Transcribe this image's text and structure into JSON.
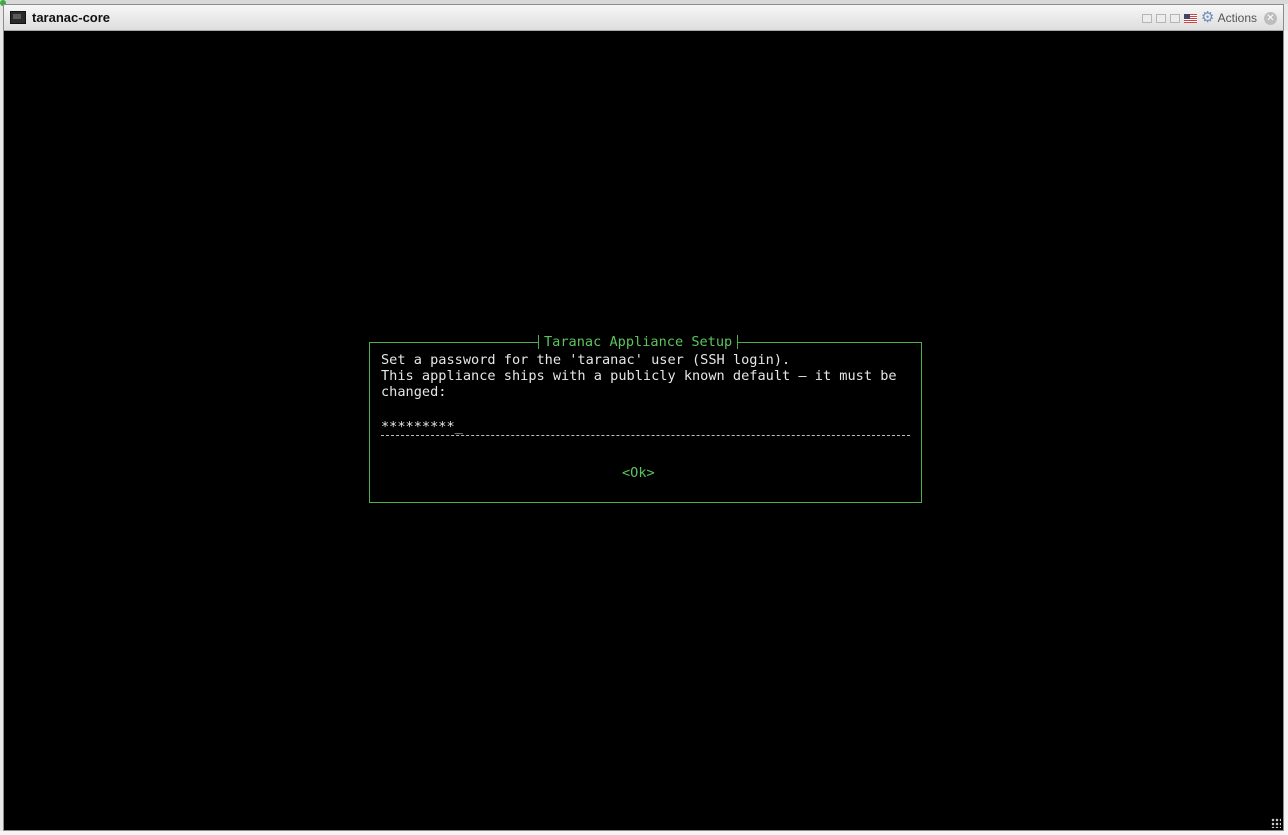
{
  "window": {
    "title": "taranac-core",
    "actions_label": "Actions"
  },
  "icons": {
    "console": "console-icon",
    "flag": "us-flag-icon",
    "gear": "gear-icon",
    "close": "close-icon"
  },
  "dialog": {
    "title": "Taranac Appliance Setup",
    "line1": "Set a password for the 'taranac' user (SSH login).",
    "line2": "This appliance ships with a publicly known default — it must be",
    "line3": "changed:",
    "password_value": "*********_",
    "ok_label": "<Ok>"
  },
  "colors": {
    "terminal_bg": "#000000",
    "terminal_text": "#e6e6e6",
    "dialog_accent": "#5cc45c"
  }
}
